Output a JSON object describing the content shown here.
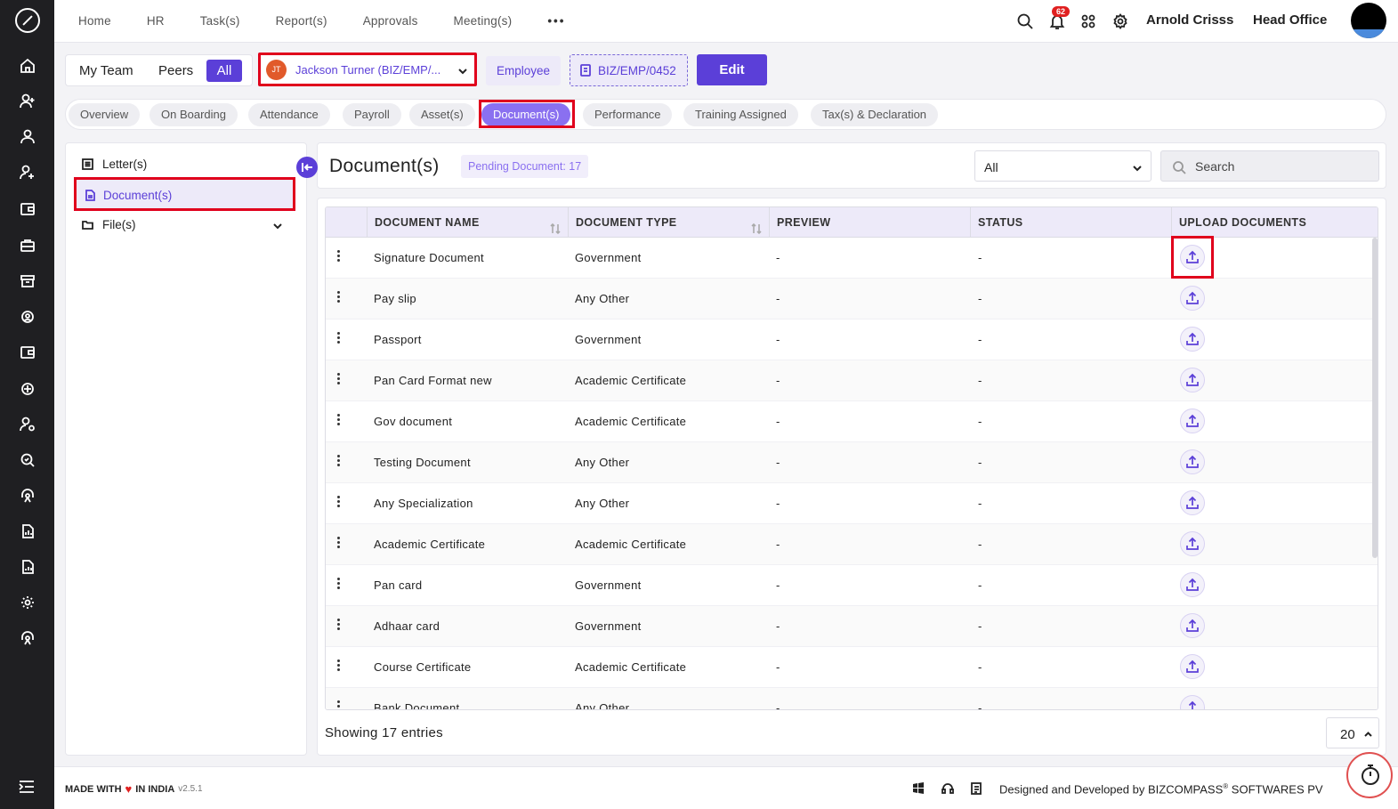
{
  "topnav": {
    "items": [
      "Home",
      "HR",
      "Task(s)",
      "Report(s)",
      "Approvals",
      "Meeting(s)"
    ],
    "more": "•••",
    "notification_count": "62",
    "user_name": "Arnold Crisss",
    "office": "Head Office"
  },
  "team_filter": {
    "my_team": "My Team",
    "peers": "Peers",
    "all": "All"
  },
  "employee": {
    "initials": "JT",
    "name": "Jackson Turner (BIZ/EMP/...",
    "role": "Employee",
    "code": "BIZ/EMP/0452",
    "edit_label": "Edit"
  },
  "tabs": [
    "Overview",
    "On Boarding",
    "Attendance",
    "Payroll",
    "Asset(s)",
    "Document(s)",
    "Performance",
    "Training Assigned",
    "Tax(s) & Declaration"
  ],
  "active_tab": "Document(s)",
  "side_menu": {
    "letters": "Letter(s)",
    "documents": "Document(s)",
    "files": "File(s)"
  },
  "main": {
    "title": "Document(s)",
    "pending": "Pending Document: 17",
    "filter_value": "All",
    "search_placeholder": "Search"
  },
  "table": {
    "headers": {
      "name": "DOCUMENT NAME",
      "type": "DOCUMENT TYPE",
      "preview": "PREVIEW",
      "status": "STATUS",
      "upload": "UPLOAD DOCUMENTS"
    },
    "rows": [
      {
        "name": "Signature Document",
        "type": "Government",
        "preview": "-",
        "status": "-"
      },
      {
        "name": "Pay slip",
        "type": "Any Other",
        "preview": "-",
        "status": "-"
      },
      {
        "name": "Passport",
        "type": "Government",
        "preview": "-",
        "status": "-"
      },
      {
        "name": "Pan Card Format new",
        "type": "Academic Certificate",
        "preview": "-",
        "status": "-"
      },
      {
        "name": "Gov document",
        "type": "Academic Certificate",
        "preview": "-",
        "status": "-"
      },
      {
        "name": "Testing Document",
        "type": "Any Other",
        "preview": "-",
        "status": "-"
      },
      {
        "name": "Any Specialization",
        "type": "Any Other",
        "preview": "-",
        "status": "-"
      },
      {
        "name": "Academic Certificate",
        "type": "Academic Certificate",
        "preview": "-",
        "status": "-"
      },
      {
        "name": "Pan card",
        "type": "Government",
        "preview": "-",
        "status": "-"
      },
      {
        "name": "Adhaar card",
        "type": "Government",
        "preview": "-",
        "status": "-"
      },
      {
        "name": "Course Certificate",
        "type": "Academic Certificate",
        "preview": "-",
        "status": "-"
      },
      {
        "name": "Bank Document",
        "type": "Any Other",
        "preview": "-",
        "status": "-"
      }
    ],
    "showing": "Showing 17 entries",
    "page_size": "20"
  },
  "footer": {
    "made_with": "MADE WITH",
    "in_india": "IN INDIA",
    "version": "v2.5.1",
    "designed": "Designed and Developed by",
    "company": "BIZCOMPASS",
    "company_suffix": "SOFTWARES PV"
  },
  "colors": {
    "accent": "#5b3fd8",
    "highlight": "#e0001c",
    "rail": "#1f1f22"
  }
}
